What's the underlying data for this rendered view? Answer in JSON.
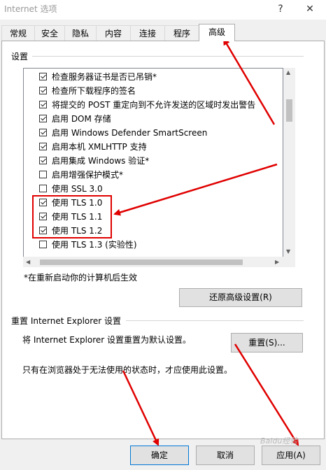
{
  "window": {
    "title": "Internet 选项",
    "help_glyph": "?",
    "close_glyph": "✕"
  },
  "tabs": [
    {
      "label": "常规"
    },
    {
      "label": "安全"
    },
    {
      "label": "隐私"
    },
    {
      "label": "内容"
    },
    {
      "label": "连接"
    },
    {
      "label": "程序"
    },
    {
      "label": "高级",
      "active": true
    }
  ],
  "settings": {
    "group_label": "设置",
    "items": [
      {
        "label": "检查服务器证书是否已吊销*",
        "checked": true
      },
      {
        "label": "检查所下载程序的签名",
        "checked": true
      },
      {
        "label": "将提交的 POST 重定向到不允许发送的区域时发出警告",
        "checked": true
      },
      {
        "label": "启用 DOM 存储",
        "checked": true
      },
      {
        "label": "启用 Windows Defender SmartScreen",
        "checked": true
      },
      {
        "label": "启用本机 XMLHTTP 支持",
        "checked": true
      },
      {
        "label": "启用集成 Windows 验证*",
        "checked": true
      },
      {
        "label": "启用增强保护模式*",
        "checked": false
      },
      {
        "label": "使用 SSL 3.0",
        "checked": false
      },
      {
        "label": "使用 TLS 1.0",
        "checked": true
      },
      {
        "label": "使用 TLS 1.1",
        "checked": true
      },
      {
        "label": "使用 TLS 1.2",
        "checked": true
      },
      {
        "label": "使用 TLS 1.3 (实验性)",
        "checked": false
      }
    ],
    "note": "*在重新启动你的计算机后生效",
    "restore_button": "还原高级设置(R)"
  },
  "reset": {
    "group_label": "重置 Internet Explorer 设置",
    "description": "将 Internet Explorer 设置重置为默认设置。",
    "button": "重置(S)...",
    "warning": "只有在浏览器处于无法使用的状态时，才应使用此设置。"
  },
  "footer": {
    "ok": "确定",
    "cancel": "取消",
    "apply": "应用(A)"
  },
  "watermark": "Baidu经验",
  "colors": {
    "annotation": "#e00000",
    "primary_border": "#0078d7"
  }
}
